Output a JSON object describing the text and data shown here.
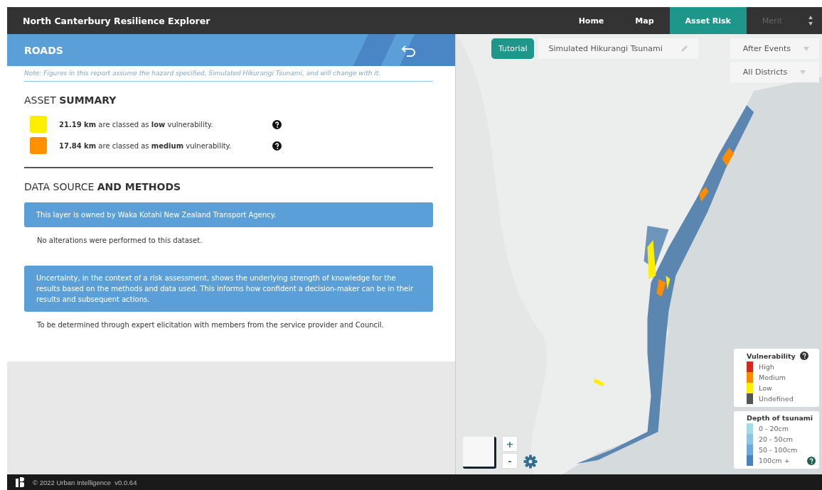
{
  "app_title": "North Canterbury Resilience Explorer",
  "nav": [
    {
      "label": "Home",
      "selected": false,
      "disabled": false
    },
    {
      "label": "Map",
      "selected": false,
      "disabled": false
    },
    {
      "label": "Asset Risk",
      "selected": true,
      "disabled": false
    },
    {
      "label": "Merit",
      "selected": false,
      "disabled": true
    }
  ],
  "panel": {
    "title": "ROADS",
    "note": "Note: Figures in this report assume the hazard specified, Simulated Hikurangi Tsunami, and will change with it.",
    "summary_heading": "ASSET **SUMMARY**",
    "summary": [
      {
        "text": "**21.19 km** are classed as **low** vulnerability.",
        "color": "#ffee00"
      },
      {
        "text": "**17.84 km** are classed as **medium** vulnerability.",
        "color": "#ff9100"
      }
    ],
    "methods_heading": "DATA SOURCE **AND METHODS**",
    "methods": [
      {
        "kind": "callout",
        "text": "This layer is owned by Waka Kotahi New Zealand Transport Agency."
      },
      {
        "kind": "plain",
        "text": "No alterations were performed to this dataset."
      },
      {
        "kind": "callout",
        "text": "Uncertainty, in the context of a risk assessment, shows the underlying strength of knowledge for the results based on the methods and data used. This informs how confident a decision-maker can be in their results and subsequent actions."
      },
      {
        "kind": "plain",
        "text": "To be determined through expert elicitation with members from the service provider and Council."
      }
    ]
  },
  "map": {
    "tutorial": "Tutorial",
    "hazard": "Simulated Hikurangi Tsunami",
    "timing": "After Events",
    "district": "All Districts",
    "zoom_in": "+",
    "zoom_out": "-",
    "vulnerability_legend": {
      "title": "Vulnerability",
      "items": [
        {
          "label": "High",
          "color": "#d42a1e"
        },
        {
          "label": "Medium",
          "color": "#ff8c00"
        },
        {
          "label": "Low",
          "color": "#ffee00"
        },
        {
          "label": "Undefined",
          "color": "#555555"
        }
      ]
    },
    "depth_legend": {
      "title": "Depth of tsunami",
      "items": [
        {
          "label": "0 - 20cm",
          "color": "#a6dbe6"
        },
        {
          "label": "20 - 50cm",
          "color": "#8cc4e6"
        },
        {
          "label": "50 - 100cm",
          "color": "#6ca8d8"
        },
        {
          "label": "100cm +",
          "color": "#4a82c0"
        }
      ]
    }
  },
  "footer": "© 2022 Urban Intelligence  v0.0.64"
}
